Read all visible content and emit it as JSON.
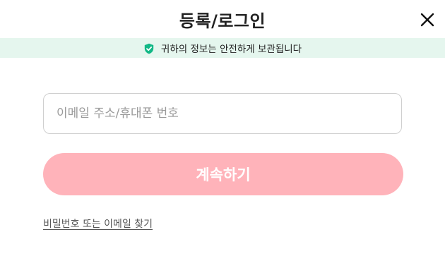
{
  "header": {
    "title": "등록/로그인",
    "close_icon": "close-icon"
  },
  "security_banner": {
    "icon": "shield-check-icon",
    "icon_color": "#12b886",
    "text": "귀하의 정보는 안전하게 보관됩니다",
    "background": "#e5f6ee"
  },
  "form": {
    "identifier_field": {
      "value": "",
      "placeholder": "이메일 주소/휴대폰 번호"
    },
    "continue_button": {
      "label": "계속하기",
      "color": "#ffb3ba"
    },
    "forgot_link": "비밀번호 또는 이메일 찾기"
  }
}
